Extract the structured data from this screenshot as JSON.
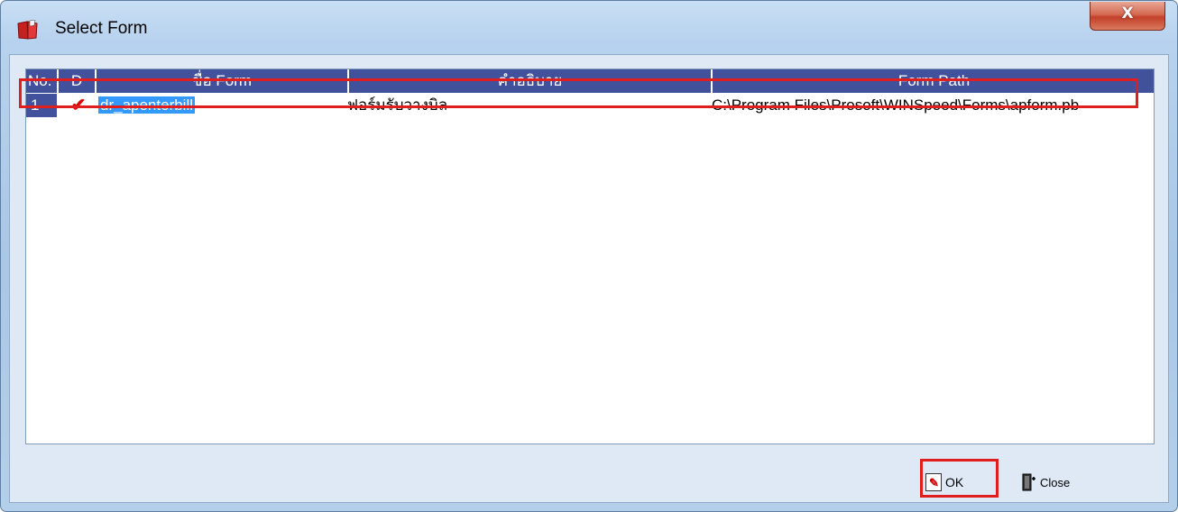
{
  "window": {
    "title": "Select Form",
    "close_glyph": "X"
  },
  "grid": {
    "columns": [
      "No.",
      "D",
      "ชื่อ Form",
      "คำอธิบาย",
      "Form Path"
    ],
    "rows": [
      {
        "no": "1",
        "checked": "✔",
        "name": "dr_apenterbill",
        "description": "ฟอร์มรับวางบิล",
        "path": "C:\\Program Files\\Prosoft\\WINSpeed\\Forms\\apform.pb"
      }
    ]
  },
  "buttons": {
    "ok_label": "OK",
    "close_label": "Close"
  },
  "colors": {
    "header_bg": "#41519c",
    "selection": "#3399ff",
    "highlight_outline": "#e01e1e",
    "check": "#e00000"
  },
  "icons": [
    "app-book-icon",
    "checkmark-icon",
    "ok-document-icon",
    "exit-door-icon"
  ]
}
